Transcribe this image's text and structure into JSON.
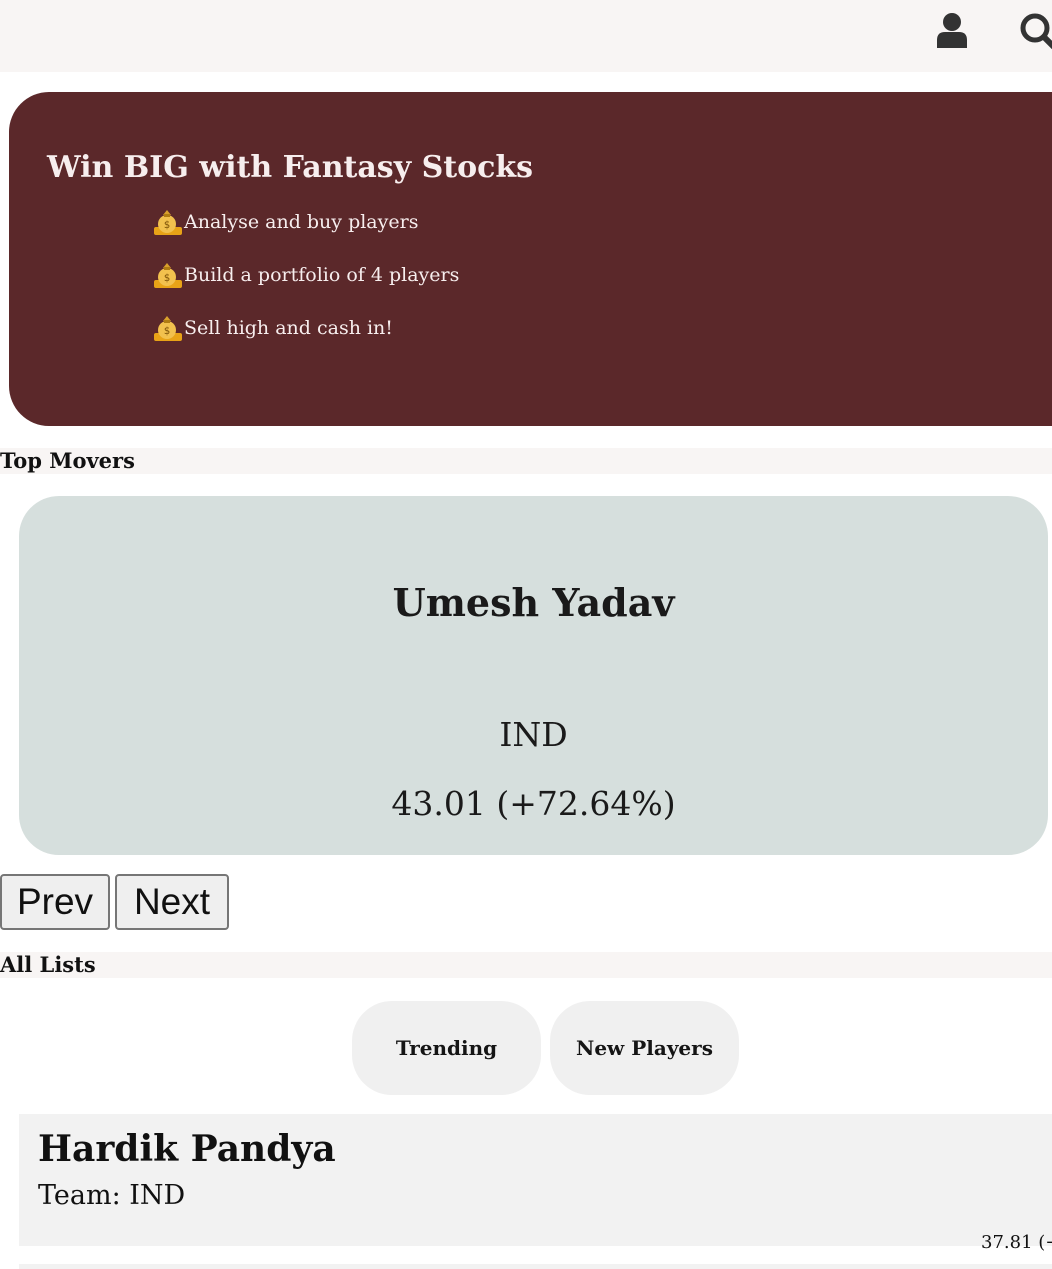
{
  "header": {
    "icons": [
      "user-icon",
      "search-icon"
    ]
  },
  "hero": {
    "title": "Win BIG with Fantasy Stocks",
    "bullet_icon": "money-bag-icon",
    "bullets": [
      "Analyse and buy players",
      "Build a portfolio of 4 players",
      "Sell high and cash in!"
    ],
    "background_color": "#5b282a"
  },
  "top_movers": {
    "heading": "Top Movers",
    "card": {
      "name": "Umesh Yadav",
      "team": "IND",
      "price": "43.01 (+72.64%)"
    },
    "prev_label": "Prev",
    "next_label": "Next"
  },
  "all_lists": {
    "heading": "All Lists",
    "tabs": [
      "Trending",
      "New Players"
    ],
    "players": [
      {
        "name": "Hardik Pandya",
        "team": "Team: IND",
        "price": "37.81 (+"
      }
    ]
  }
}
